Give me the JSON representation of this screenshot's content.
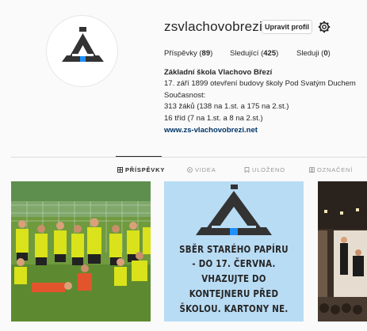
{
  "profile": {
    "username": "zsvlachovobrezi",
    "edit_button": "Upravit profil",
    "stats": [
      {
        "label": "Příspěvky",
        "count": "89"
      },
      {
        "label": "Sledující",
        "count": "425"
      },
      {
        "label": "Sleduji",
        "count": "0"
      }
    ],
    "bio": {
      "name": "Základní škola Vlachovo Březí",
      "lines": [
        "17. září 1899 otevření budovy školy Pod Svatým Duchem",
        "Současnost:",
        "313 žáků (138 na 1.st. a 175 na 2.st.)",
        "16 tříd (7 na 1.st. a 8 na 2.st.)"
      ],
      "website": "www.zs-vlachovobrezi.net"
    }
  },
  "tabs": [
    {
      "label": "PŘÍSPĚVKY",
      "icon": "grid-icon",
      "active": true
    },
    {
      "label": "VIDEA",
      "icon": "video-icon",
      "active": false
    },
    {
      "label": "ULOŽENO",
      "icon": "bookmark-icon",
      "active": false
    },
    {
      "label": "OZNAČENÍ",
      "icon": "tagged-icon",
      "active": false
    }
  ],
  "posts": [
    {
      "kind": "photo-football-team"
    },
    {
      "kind": "poster",
      "lines": [
        "SBĚR STARÉHO PAPÍRU",
        "- DO 17. ČERVNA.",
        "VHAZUJTE DO",
        "KONTEJNERU PŘED",
        "ŠKOLOU. KARTONY NE."
      ]
    },
    {
      "kind": "photo-concert-hall"
    }
  ],
  "colors": {
    "logo": "#333333",
    "logo_accent": "#1e90ff",
    "poster_bg": "#b9dcf5",
    "link": "#003569"
  }
}
